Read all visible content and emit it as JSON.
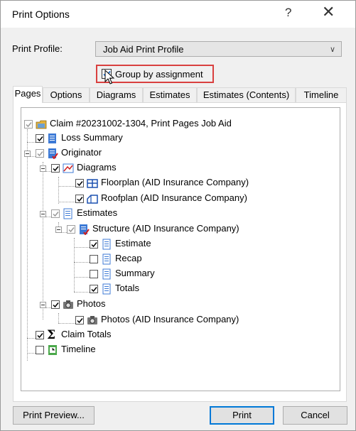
{
  "window": {
    "title": "Print Options",
    "help": "?",
    "close": "✕"
  },
  "profile": {
    "label": "Print Profile:",
    "value": "Job Aid Print Profile"
  },
  "group_by": {
    "label": "Group by assignment",
    "checked": true
  },
  "tabs": [
    "Pages",
    "Options",
    "Diagrams",
    "Estimates",
    "Estimates (Contents)",
    "Timeline"
  ],
  "active_tab": "Pages",
  "tree": {
    "claim": "Claim #20231002-1304, Print Pages Job Aid",
    "loss_summary": "Loss Summary",
    "originator": "Originator",
    "diagrams": "Diagrams",
    "floorplan": "Floorplan (AID Insurance Company)",
    "roofplan": "Roofplan (AID Insurance Company)",
    "estimates": "Estimates",
    "structure": "Structure (AID Insurance Company)",
    "estimate": "Estimate",
    "recap": "Recap",
    "summary": "Summary",
    "totals": "Totals",
    "photos": "Photos",
    "photos_item": "Photos (AID Insurance Company)",
    "claim_totals": "Claim Totals",
    "timeline": "Timeline"
  },
  "buttons": {
    "preview": "Print Preview...",
    "print": "Print",
    "cancel": "Cancel"
  },
  "colors": {
    "highlight_border": "#d9403f",
    "default_button": "#0078d7"
  }
}
